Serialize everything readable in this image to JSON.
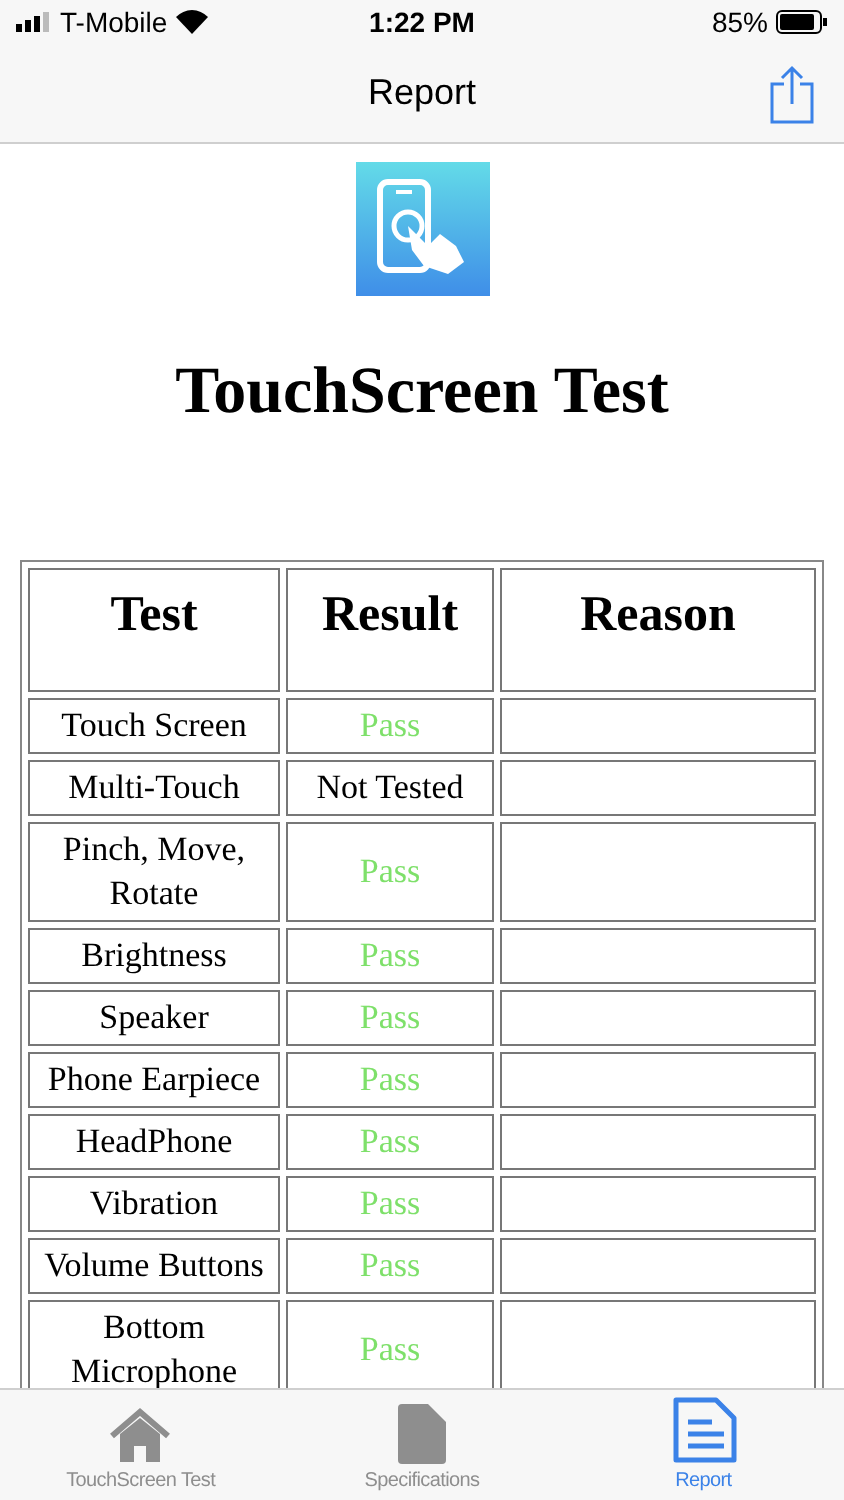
{
  "status_bar": {
    "carrier": "T-Mobile",
    "time": "1:22 PM",
    "battery": "85%"
  },
  "nav_bar": {
    "title": "Report"
  },
  "report": {
    "title": "TouchScreen Test",
    "table": {
      "columns": [
        "Test",
        "Result",
        "Reason"
      ],
      "rows": [
        {
          "test": "Touch Screen",
          "result": "Pass",
          "kind": "pass"
        },
        {
          "test": "Multi-Touch",
          "result": "Not Tested",
          "kind": "not_tested"
        },
        {
          "test": "Pinch, Move, Rotate",
          "result": "Pass",
          "kind": "pass"
        },
        {
          "test": "Brightness",
          "result": "Pass",
          "kind": "pass"
        },
        {
          "test": "Speaker",
          "result": "Pass",
          "kind": "pass"
        },
        {
          "test": "Phone Earpiece",
          "result": "Pass",
          "kind": "pass"
        },
        {
          "test": "HeadPhone",
          "result": "Pass",
          "kind": "pass"
        },
        {
          "test": "Vibration",
          "result": "Pass",
          "kind": "pass"
        },
        {
          "test": "Volume Buttons",
          "result": "Pass",
          "kind": "pass"
        },
        {
          "test": "Bottom Microphone",
          "result": "Pass",
          "kind": "pass"
        }
      ]
    }
  },
  "tab_bar": [
    {
      "label": "TouchScreen Test",
      "kind": "home",
      "selected": false
    },
    {
      "label": "Specifications",
      "kind": "document",
      "selected": false
    },
    {
      "label": "Report",
      "kind": "report",
      "selected": true
    }
  ]
}
